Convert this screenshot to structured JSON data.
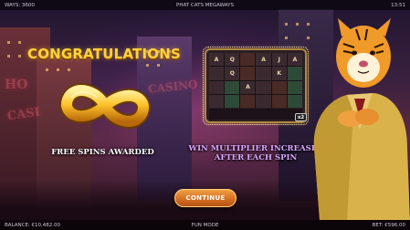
{
  "topbar": {
    "ways": "WAYS: 3600",
    "title": "PHAT CATS MEGAWAYS",
    "time": "13:51"
  },
  "bottombar": {
    "balance": "BALANCE: €10,482.00",
    "mode": "FUN MODE",
    "bet": "BET: €596.00"
  },
  "popup": {
    "heading": "CONGRATULATIONS",
    "free_spins_label": "FREE SPINS AWARDED",
    "multiplier_line1": "WIN MULTIPLIER INCREASES",
    "multiplier_line2": "AFTER EACH SPIN",
    "multiplier_badge": "x2",
    "continue_label": "CONTINUE"
  },
  "reel_symbols": [
    "A",
    "Q",
    "",
    "A",
    "J",
    "A",
    "",
    "Q",
    "",
    "",
    "K",
    "",
    "",
    "",
    "A",
    "",
    "",
    "",
    "",
    "",
    "",
    "",
    "",
    ""
  ],
  "colors": {
    "gold": "#ffd23a",
    "purple_text": "#d9a8ff",
    "button_orange": "#d67020"
  },
  "icons": {
    "infinity": "infinity-icon",
    "tiger": "tiger-character"
  }
}
